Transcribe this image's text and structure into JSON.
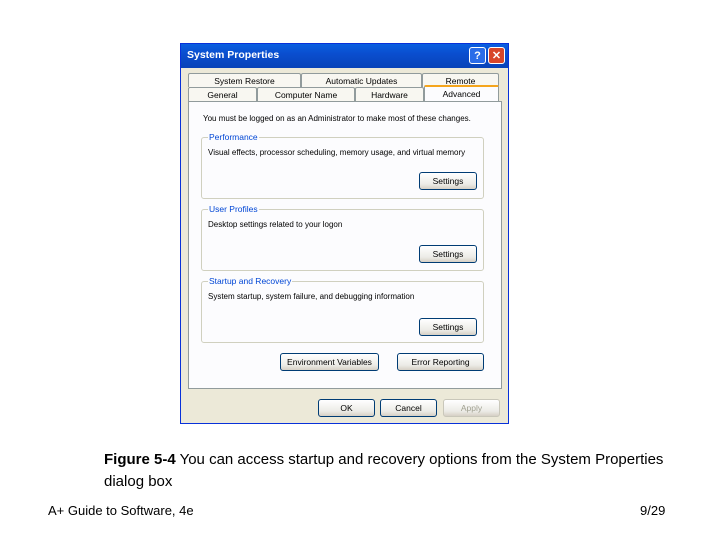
{
  "dialog": {
    "title": "System Properties",
    "help_glyph": "?",
    "close_glyph": "✕",
    "tabs_top": [
      "System Restore",
      "Automatic Updates",
      "Remote"
    ],
    "tabs_bottom": [
      "General",
      "Computer Name",
      "Hardware",
      "Advanced"
    ],
    "active_tab": "Advanced",
    "admin_note": "You must be logged on as an Administrator to make most of these changes.",
    "groups": [
      {
        "title": "Performance",
        "description": "Visual effects, processor scheduling, memory usage, and virtual memory",
        "button": "Settings"
      },
      {
        "title": "User Profiles",
        "description": "Desktop settings related to your logon",
        "button": "Settings"
      },
      {
        "title": "Startup and Recovery",
        "description": "System startup, system failure, and debugging information",
        "button": "Settings"
      }
    ],
    "env_button": "Environment Variables",
    "error_button": "Error Reporting",
    "ok_button": "OK",
    "cancel_button": "Cancel",
    "apply_button": "Apply"
  },
  "caption": {
    "label": "Figure 5-4",
    "text": " You can access startup and recovery options from the System Properties dialog box"
  },
  "footer": {
    "book": "A+ Guide to Software, 4e",
    "page": "9/29"
  }
}
